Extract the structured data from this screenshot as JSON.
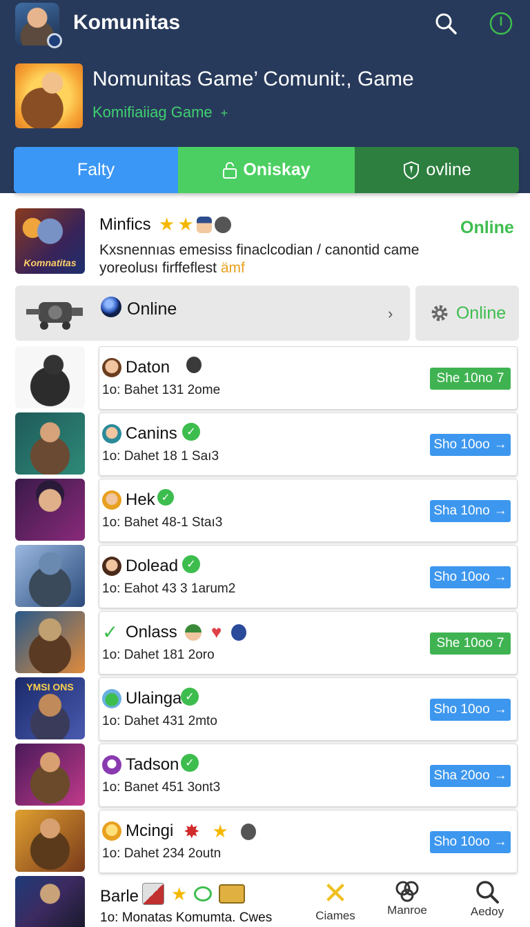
{
  "header": {
    "app_title": "Komunitas",
    "banner_title": "Nomunitas Game’ Comunit:, Game",
    "banner_subtitle": "Komifiaiiag Game",
    "banner_subtitle_arrow": "+"
  },
  "tabs": [
    {
      "label": "Falty"
    },
    {
      "label": "Oniskay"
    },
    {
      "label": "ovline"
    }
  ],
  "featured": {
    "name": "Minfics",
    "status": "Online",
    "art_label": "Komnatitas",
    "description_line1": "Kxsnennıas emesiss finaclcodian / canontid came",
    "description_line2": "yoreolusı firffeflest",
    "description_highlight": "ämf"
  },
  "online_strip": {
    "label": "Online",
    "button_label": "Online"
  },
  "list": [
    {
      "name": "Daton",
      "meta": "1o: Bahet 131 2ome",
      "button": "She 10no",
      "button_icon": "7",
      "color": "green"
    },
    {
      "name": "Canins",
      "meta": "1o: Dahet 18 1 Saı3",
      "button": "Sho 10oo",
      "button_icon": "→",
      "color": "blue"
    },
    {
      "name": "Hek",
      "meta": "1o: Bahet 48-1 Staı3",
      "button": "Sha 10no",
      "button_icon": "→",
      "color": "blue"
    },
    {
      "name": "Dolead",
      "meta": "1o: Eahot 43 3 1arum2",
      "button": "Sho 10oo",
      "button_icon": "→",
      "color": "blue"
    },
    {
      "name": "Onlass",
      "meta": "1o: Dahet 181 2oro",
      "button": "She 10oo",
      "button_icon": "7",
      "color": "green"
    },
    {
      "name": "Ulainga",
      "meta": "1o: Dahet 431 2mto",
      "button": "Sho 10oo",
      "button_icon": "→",
      "color": "blue"
    },
    {
      "name": "Tadson",
      "meta": "1o: Banet 451 3ont3",
      "button": "Sha 20oo",
      "button_icon": "→",
      "color": "blue"
    },
    {
      "name": "Mcingi",
      "meta": "1o: Dahet 234 2outn",
      "button": "Sho 10oo",
      "button_icon": "→",
      "color": "blue"
    }
  ],
  "bottom": {
    "name": "Barle",
    "meta": "1o: Monatas Komumta. Cwes",
    "nav": [
      {
        "label": "Ciames"
      },
      {
        "label": "Manroe"
      },
      {
        "label": "Aedoy"
      }
    ]
  }
}
